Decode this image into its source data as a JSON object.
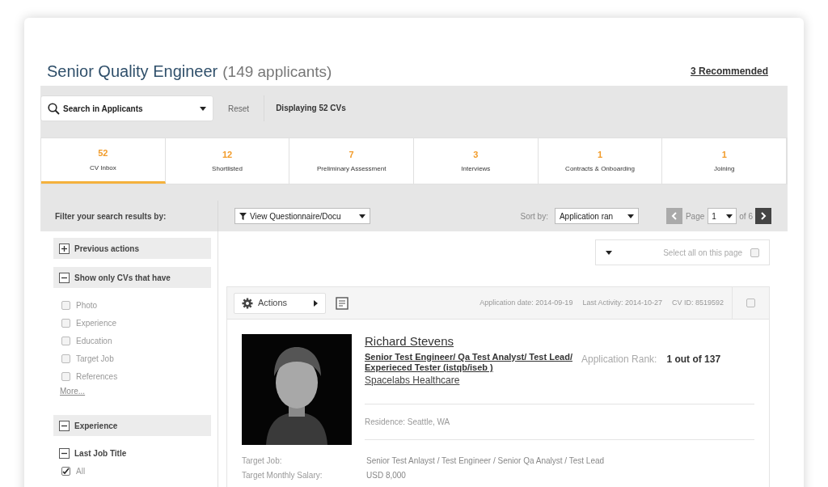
{
  "header": {
    "title": "Senior Quality Engineer",
    "count": "(149 applicants)",
    "recommended_link": "3 Recommended"
  },
  "search_bar": {
    "placeholder": "Search in Applicants",
    "reset": "Reset",
    "status": "Displaying 52 CVs"
  },
  "tabs": [
    {
      "count": "52",
      "label": "CV Inbox",
      "selected": true
    },
    {
      "count": "12",
      "label": "Shortlisted",
      "selected": false
    },
    {
      "count": "7",
      "label": "Preliminary Assessment",
      "selected": false
    },
    {
      "count": "3",
      "label": "Interviews",
      "selected": false
    },
    {
      "count": "1",
      "label": "Contracts & Onboarding",
      "selected": false
    },
    {
      "count": "1",
      "label": "Joining",
      "selected": false
    }
  ],
  "filter_bar": {
    "title": "Filter your search results by:",
    "view_select": "View Questionnaire/Docu",
    "sort_label": "Sort by:",
    "sort_select": "Application ran",
    "page_label": "Page",
    "page_select": "1",
    "page_total": "of 6",
    "prev_disabled": true,
    "next_disabled": false
  },
  "sidebar": [
    {
      "kind": "section",
      "label": "Previous actions",
      "expanded": false
    },
    {
      "kind": "section",
      "label": "Show only CVs that have",
      "expanded": true
    },
    {
      "kind": "checkbox",
      "label": "Photo",
      "checked": false
    },
    {
      "kind": "checkbox",
      "label": "Experience",
      "checked": false
    },
    {
      "kind": "checkbox",
      "label": "Education",
      "checked": false
    },
    {
      "kind": "checkbox",
      "label": "Target Job",
      "checked": false
    },
    {
      "kind": "checkbox",
      "label": "References",
      "checked": false
    },
    {
      "kind": "link",
      "label": "More..."
    },
    {
      "kind": "section",
      "label": "Experience",
      "expanded": true
    },
    {
      "kind": "subsection",
      "label": "Last Job Title",
      "expanded": true
    },
    {
      "kind": "checkbox",
      "label": "All",
      "checked": true
    }
  ],
  "select_all": {
    "label": "Select all on this page",
    "checked": false
  },
  "application": {
    "actions": "Actions",
    "application_date": "Application date: 2014-09-19",
    "last_activity": "Last Activity: 2014-10-27",
    "cv_id": "CV ID: 8519592",
    "selected": false,
    "name": "Richard Stevens",
    "job_title": "Senior Test Engineer/ Qa Test Analyst/ Test Lead/ Experieced Tester (istqb/iseb )",
    "company": "Spacelabs Healthcare",
    "rank_label": "Application Rank:",
    "rank_value": "1 out of 137",
    "residence": "Residence: Seattle, WA",
    "details": [
      {
        "label": "Target Job:",
        "value": "Senior Test Anlayst / Test Engineer / Senior Qa Analyst / Test Lead"
      },
      {
        "label": "Target Monthly Salary:",
        "value": "USD 8,000"
      }
    ]
  }
}
